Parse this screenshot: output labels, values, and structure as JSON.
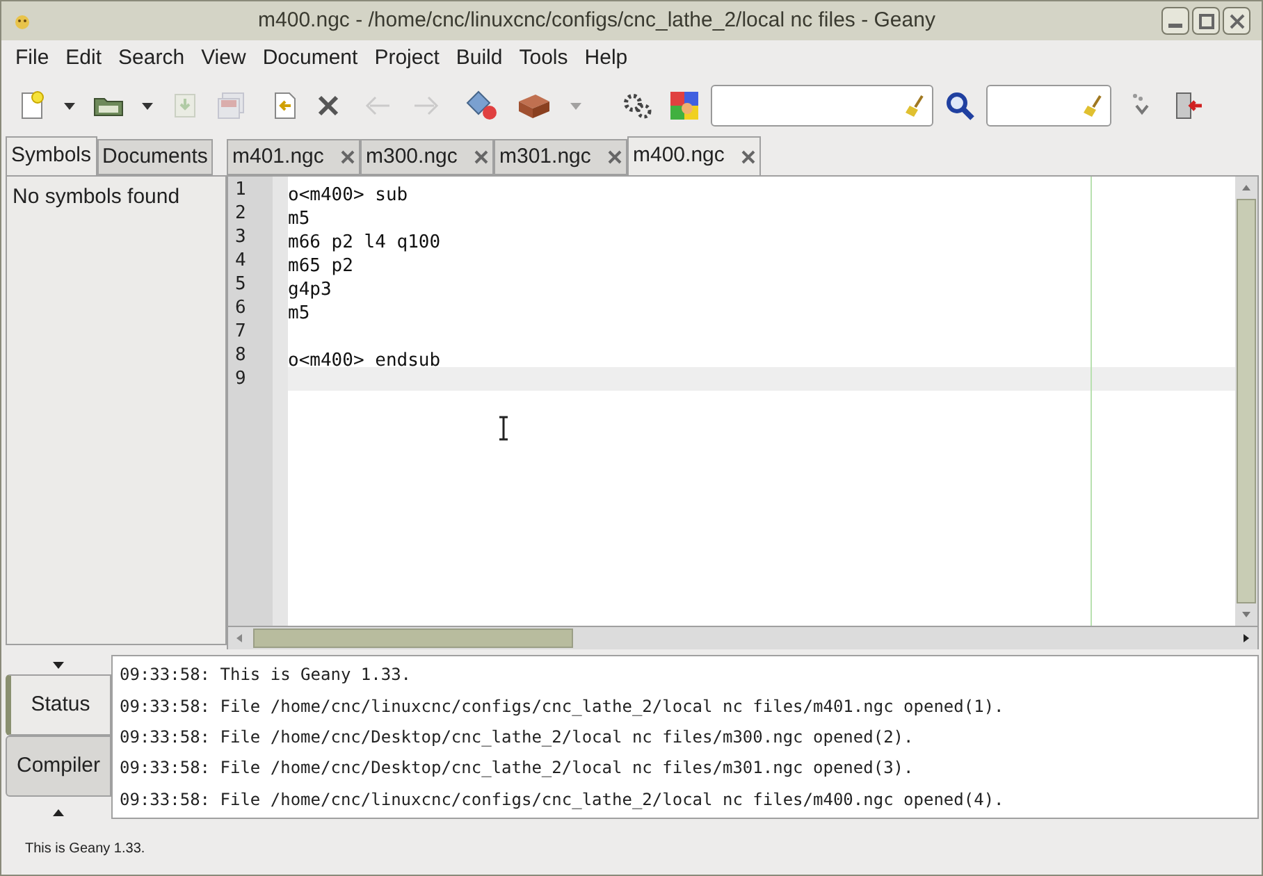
{
  "window": {
    "title": "m400.ngc - /home/cnc/linuxcnc/configs/cnc_lathe_2/local nc files - Geany"
  },
  "menu": [
    "File",
    "Edit",
    "Search",
    "View",
    "Document",
    "Project",
    "Build",
    "Tools",
    "Help"
  ],
  "toolbar": [
    {
      "kind": "new",
      "disabled": false
    },
    {
      "kind": "caret",
      "disabled": false
    },
    {
      "kind": "open",
      "disabled": false
    },
    {
      "kind": "caret",
      "disabled": false
    },
    {
      "kind": "save",
      "disabled": true
    },
    {
      "kind": "saveall",
      "disabled": true
    },
    {
      "kind": "revert",
      "disabled": false
    },
    {
      "kind": "close",
      "disabled": false
    },
    {
      "kind": "back",
      "disabled": true
    },
    {
      "kind": "forward",
      "disabled": true
    },
    {
      "kind": "compile",
      "disabled": false
    },
    {
      "kind": "build",
      "disabled": false
    },
    {
      "kind": "caret",
      "disabled": true
    },
    {
      "kind": "gears",
      "disabled": false
    },
    {
      "kind": "color",
      "disabled": false
    },
    {
      "kind": "searchfield",
      "disabled": false
    },
    {
      "kind": "find",
      "disabled": false
    },
    {
      "kind": "gotofield",
      "disabled": false
    },
    {
      "kind": "jump",
      "disabled": false
    },
    {
      "kind": "quit",
      "disabled": false
    }
  ],
  "sidebar": {
    "tabs": [
      {
        "label": "Symbols",
        "selected": true
      },
      {
        "label": "Documents",
        "selected": false
      }
    ],
    "message": "No symbols found"
  },
  "editor": {
    "tabs": [
      {
        "label": "m401.ngc",
        "selected": false
      },
      {
        "label": "m300.ngc",
        "selected": false
      },
      {
        "label": "m301.ngc",
        "selected": false
      },
      {
        "label": "m400.ngc",
        "selected": true
      }
    ],
    "lines": [
      {
        "number": "1",
        "text": "o<m400> sub",
        "current": false
      },
      {
        "number": "2",
        "text": "m5",
        "current": false
      },
      {
        "number": "3",
        "text": "m66 p2 l4 q100",
        "current": false
      },
      {
        "number": "4",
        "text": "m65 p2",
        "current": false
      },
      {
        "number": "5",
        "text": "g4p3",
        "current": false
      },
      {
        "number": "6",
        "text": "m5",
        "current": false
      },
      {
        "number": "7",
        "current": false
      },
      {
        "number": "8",
        "text": "o<m400> endsub",
        "current": false
      },
      {
        "number": "9",
        "current": true
      }
    ]
  },
  "messages": {
    "tabs": [
      {
        "label": "Status",
        "selected": true
      },
      {
        "label": "Compiler",
        "selected": false
      }
    ],
    "lines": [
      "09:33:58: This is Geany 1.33.",
      "09:33:58: File /home/cnc/linuxcnc/configs/cnc_lathe_2/local nc files/m401.ngc opened(1).",
      "09:33:58: File /home/cnc/Desktop/cnc_lathe_2/local nc files/m300.ngc opened(2).",
      "09:33:58: File /home/cnc/Desktop/cnc_lathe_2/local nc files/m301.ngc opened(3).",
      "09:33:58: File /home/cnc/linuxcnc/configs/cnc_lathe_2/local nc files/m400.ngc opened(4)."
    ]
  },
  "status_bar": "This is Geany 1.33."
}
